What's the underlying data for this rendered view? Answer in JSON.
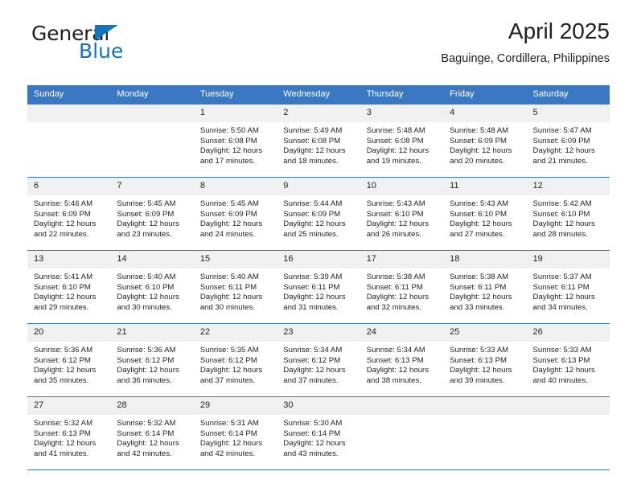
{
  "brand": {
    "name_top": "General",
    "name_bottom": "Blue",
    "triangle_color": "#1275bc"
  },
  "header": {
    "title": "April 2025",
    "subtitle": "Baguinge, Cordillera, Philippines"
  },
  "theme": {
    "header_blue": "#3a78c2",
    "daynum_band": "#f0f0f0",
    "text": "#231f20"
  },
  "weekday_headers": [
    "Sunday",
    "Monday",
    "Tuesday",
    "Wednesday",
    "Thursday",
    "Friday",
    "Saturday"
  ],
  "weeks": [
    [
      {
        "day": "",
        "empty": true
      },
      {
        "day": "",
        "empty": true
      },
      {
        "day": "1",
        "sunrise": "Sunrise: 5:50 AM",
        "sunset": "Sunset: 6:08 PM",
        "daylight1": "Daylight: 12 hours",
        "daylight2": "and 17 minutes."
      },
      {
        "day": "2",
        "sunrise": "Sunrise: 5:49 AM",
        "sunset": "Sunset: 6:08 PM",
        "daylight1": "Daylight: 12 hours",
        "daylight2": "and 18 minutes."
      },
      {
        "day": "3",
        "sunrise": "Sunrise: 5:48 AM",
        "sunset": "Sunset: 6:08 PM",
        "daylight1": "Daylight: 12 hours",
        "daylight2": "and 19 minutes."
      },
      {
        "day": "4",
        "sunrise": "Sunrise: 5:48 AM",
        "sunset": "Sunset: 6:09 PM",
        "daylight1": "Daylight: 12 hours",
        "daylight2": "and 20 minutes."
      },
      {
        "day": "5",
        "sunrise": "Sunrise: 5:47 AM",
        "sunset": "Sunset: 6:09 PM",
        "daylight1": "Daylight: 12 hours",
        "daylight2": "and 21 minutes."
      }
    ],
    [
      {
        "day": "6",
        "sunrise": "Sunrise: 5:46 AM",
        "sunset": "Sunset: 6:09 PM",
        "daylight1": "Daylight: 12 hours",
        "daylight2": "and 22 minutes."
      },
      {
        "day": "7",
        "sunrise": "Sunrise: 5:45 AM",
        "sunset": "Sunset: 6:09 PM",
        "daylight1": "Daylight: 12 hours",
        "daylight2": "and 23 minutes."
      },
      {
        "day": "8",
        "sunrise": "Sunrise: 5:45 AM",
        "sunset": "Sunset: 6:09 PM",
        "daylight1": "Daylight: 12 hours",
        "daylight2": "and 24 minutes."
      },
      {
        "day": "9",
        "sunrise": "Sunrise: 5:44 AM",
        "sunset": "Sunset: 6:09 PM",
        "daylight1": "Daylight: 12 hours",
        "daylight2": "and 25 minutes."
      },
      {
        "day": "10",
        "sunrise": "Sunrise: 5:43 AM",
        "sunset": "Sunset: 6:10 PM",
        "daylight1": "Daylight: 12 hours",
        "daylight2": "and 26 minutes."
      },
      {
        "day": "11",
        "sunrise": "Sunrise: 5:43 AM",
        "sunset": "Sunset: 6:10 PM",
        "daylight1": "Daylight: 12 hours",
        "daylight2": "and 27 minutes."
      },
      {
        "day": "12",
        "sunrise": "Sunrise: 5:42 AM",
        "sunset": "Sunset: 6:10 PM",
        "daylight1": "Daylight: 12 hours",
        "daylight2": "and 28 minutes."
      }
    ],
    [
      {
        "day": "13",
        "sunrise": "Sunrise: 5:41 AM",
        "sunset": "Sunset: 6:10 PM",
        "daylight1": "Daylight: 12 hours",
        "daylight2": "and 29 minutes."
      },
      {
        "day": "14",
        "sunrise": "Sunrise: 5:40 AM",
        "sunset": "Sunset: 6:10 PM",
        "daylight1": "Daylight: 12 hours",
        "daylight2": "and 30 minutes."
      },
      {
        "day": "15",
        "sunrise": "Sunrise: 5:40 AM",
        "sunset": "Sunset: 6:11 PM",
        "daylight1": "Daylight: 12 hours",
        "daylight2": "and 30 minutes."
      },
      {
        "day": "16",
        "sunrise": "Sunrise: 5:39 AM",
        "sunset": "Sunset: 6:11 PM",
        "daylight1": "Daylight: 12 hours",
        "daylight2": "and 31 minutes."
      },
      {
        "day": "17",
        "sunrise": "Sunrise: 5:38 AM",
        "sunset": "Sunset: 6:11 PM",
        "daylight1": "Daylight: 12 hours",
        "daylight2": "and 32 minutes."
      },
      {
        "day": "18",
        "sunrise": "Sunrise: 5:38 AM",
        "sunset": "Sunset: 6:11 PM",
        "daylight1": "Daylight: 12 hours",
        "daylight2": "and 33 minutes."
      },
      {
        "day": "19",
        "sunrise": "Sunrise: 5:37 AM",
        "sunset": "Sunset: 6:11 PM",
        "daylight1": "Daylight: 12 hours",
        "daylight2": "and 34 minutes."
      }
    ],
    [
      {
        "day": "20",
        "sunrise": "Sunrise: 5:36 AM",
        "sunset": "Sunset: 6:12 PM",
        "daylight1": "Daylight: 12 hours",
        "daylight2": "and 35 minutes."
      },
      {
        "day": "21",
        "sunrise": "Sunrise: 5:36 AM",
        "sunset": "Sunset: 6:12 PM",
        "daylight1": "Daylight: 12 hours",
        "daylight2": "and 36 minutes."
      },
      {
        "day": "22",
        "sunrise": "Sunrise: 5:35 AM",
        "sunset": "Sunset: 6:12 PM",
        "daylight1": "Daylight: 12 hours",
        "daylight2": "and 37 minutes."
      },
      {
        "day": "23",
        "sunrise": "Sunrise: 5:34 AM",
        "sunset": "Sunset: 6:12 PM",
        "daylight1": "Daylight: 12 hours",
        "daylight2": "and 37 minutes."
      },
      {
        "day": "24",
        "sunrise": "Sunrise: 5:34 AM",
        "sunset": "Sunset: 6:13 PM",
        "daylight1": "Daylight: 12 hours",
        "daylight2": "and 38 minutes."
      },
      {
        "day": "25",
        "sunrise": "Sunrise: 5:33 AM",
        "sunset": "Sunset: 6:13 PM",
        "daylight1": "Daylight: 12 hours",
        "daylight2": "and 39 minutes."
      },
      {
        "day": "26",
        "sunrise": "Sunrise: 5:33 AM",
        "sunset": "Sunset: 6:13 PM",
        "daylight1": "Daylight: 12 hours",
        "daylight2": "and 40 minutes."
      }
    ],
    [
      {
        "day": "27",
        "sunrise": "Sunrise: 5:32 AM",
        "sunset": "Sunset: 6:13 PM",
        "daylight1": "Daylight: 12 hours",
        "daylight2": "and 41 minutes."
      },
      {
        "day": "28",
        "sunrise": "Sunrise: 5:32 AM",
        "sunset": "Sunset: 6:14 PM",
        "daylight1": "Daylight: 12 hours",
        "daylight2": "and 42 minutes."
      },
      {
        "day": "29",
        "sunrise": "Sunrise: 5:31 AM",
        "sunset": "Sunset: 6:14 PM",
        "daylight1": "Daylight: 12 hours",
        "daylight2": "and 42 minutes."
      },
      {
        "day": "30",
        "sunrise": "Sunrise: 5:30 AM",
        "sunset": "Sunset: 6:14 PM",
        "daylight1": "Daylight: 12 hours",
        "daylight2": "and 43 minutes."
      },
      {
        "day": "",
        "empty": true
      },
      {
        "day": "",
        "empty": true
      },
      {
        "day": "",
        "empty": true
      }
    ]
  ]
}
